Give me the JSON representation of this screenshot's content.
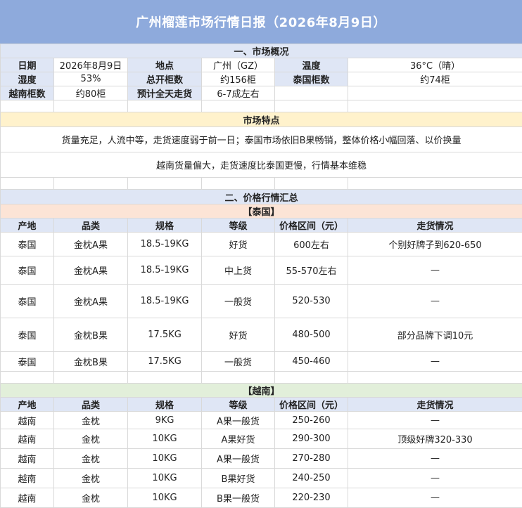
{
  "title": "广州榴莲市场行情日报（2026年8月9日）",
  "overview": {
    "section": "一、市场概况",
    "date_label": "日期",
    "date_value": "2026年8月9日",
    "place_label": "地点",
    "place_value": "广州（GZ）",
    "temp_label": "温度",
    "temp_value": "36°C（晴）",
    "humidity_label": "湿度",
    "humidity_value": "53%",
    "open_label": "总开柜数",
    "open_value": "约156柜",
    "thai_label": "泰国柜数",
    "thai_value": "约74柜",
    "viet_label": "越南柜数",
    "viet_value": "约80柜",
    "forecast_label": "预计全天走货",
    "forecast_value": "6-7成左右"
  },
  "features": {
    "heading": "市场特点",
    "line1": "货量充足，人流中等，走货速度弱于前一日；泰国市场依旧B果畅销，整体价格小幅回落、以价换量",
    "line2": "越南货量偏大，走货速度比泰国更慢，行情基本维稳"
  },
  "prices": {
    "section": "二、价格行情汇总",
    "headers": [
      "产地",
      "品类",
      "规格",
      "等级",
      "价格区间（元）",
      "走货情况"
    ],
    "thai_title": "【泰国】",
    "thai_rows": [
      [
        "泰国",
        "金枕A果",
        "18.5-19KG",
        "好货",
        "600左右",
        "个别好牌子到620-650"
      ],
      [
        "泰国",
        "金枕A果",
        "18.5-19KG",
        "中上货",
        "55-570左右",
        "—"
      ],
      [
        "泰国",
        "金枕A果",
        "18.5-19KG",
        "一般货",
        "520-530",
        "—"
      ],
      [
        "泰国",
        "金枕B果",
        "17.5KG",
        "好货",
        "480-500",
        "部分品牌下调10元"
      ],
      [
        "泰国",
        "金枕B果",
        "17.5KG",
        "一般货",
        "450-460",
        "—"
      ]
    ],
    "viet_title": "【越南】",
    "viet_rows": [
      [
        "越南",
        "金枕",
        "9KG",
        "A果一般货",
        "250-260",
        "—"
      ],
      [
        "越南",
        "金枕",
        "10KG",
        "A果好货",
        "290-300",
        "顶级好牌320-330"
      ],
      [
        "越南",
        "金枕",
        "10KG",
        "A果一般货",
        "270-280",
        "—"
      ],
      [
        "越南",
        "金枕",
        "10KG",
        "B果好货",
        "240-250",
        "—"
      ],
      [
        "越南",
        "金枕",
        "10KG",
        "B果一般货",
        "220-230",
        "—"
      ]
    ]
  }
}
